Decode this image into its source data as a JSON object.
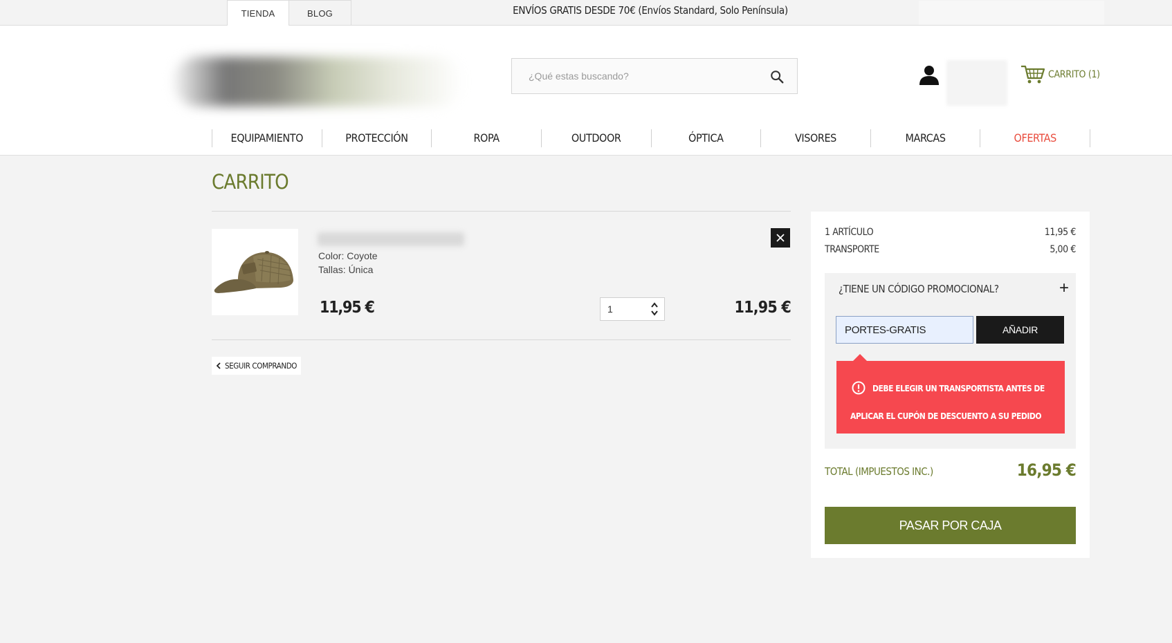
{
  "topbar": {
    "tabs": [
      {
        "label": "TIENDA",
        "active": true
      },
      {
        "label": "BLOG",
        "active": false
      }
    ],
    "promo": "ENVÍOS GRATIS DESDE 70€ (Envíos Standard, Solo Península)"
  },
  "header": {
    "search_placeholder": "¿Qué estas buscando?",
    "cart_label": "CARRITO (1)",
    "icons": [
      "search-icon",
      "user-icon",
      "cart-icon"
    ]
  },
  "nav": {
    "items": [
      {
        "label": "EQUIPAMIENTO"
      },
      {
        "label": "PROTECCIÓN"
      },
      {
        "label": "ROPA"
      },
      {
        "label": "OUTDOOR"
      },
      {
        "label": "ÓPTICA"
      },
      {
        "label": "VISORES"
      },
      {
        "label": "MARCAS"
      },
      {
        "label": "OFERTAS"
      }
    ]
  },
  "page": {
    "title": "CARRITO"
  },
  "cart": {
    "item": {
      "attributes": [
        {
          "name": "Color",
          "value": "Coyote"
        },
        {
          "name": "Tallas",
          "value": "Única"
        }
      ],
      "color_line": "Color: Coyote",
      "size_line": "Tallas: Única",
      "unit_price": "11,95 €",
      "quantity": "1",
      "line_total": "11,95 €"
    },
    "continue_label": "SEGUIR COMPRANDO"
  },
  "summary": {
    "items_label": "1 ARTÍCULO",
    "items_value": "11,95 €",
    "shipping_label": "TRANSPORTE",
    "shipping_value": "5,00 €",
    "promo_title": "¿TIENE UN CÓDIGO PROMOCIONAL?",
    "promo_code": "PORTES-GRATIS",
    "add_label": "AÑADIR",
    "alert": "DEBE ELEGIR UN TRANSPORTISTA ANTES DE APLICAR EL CUPÓN DE DESCUENTO A SU PEDIDO",
    "total_label": "TOTAL (IMPUESTOS INC.)",
    "total_value": "16,95 €",
    "checkout_label": "PASAR POR CAJA"
  },
  "colors": {
    "brand_green": "#6b7b2e",
    "offer_red": "#e94b3c",
    "alert_red": "#f6484f"
  }
}
